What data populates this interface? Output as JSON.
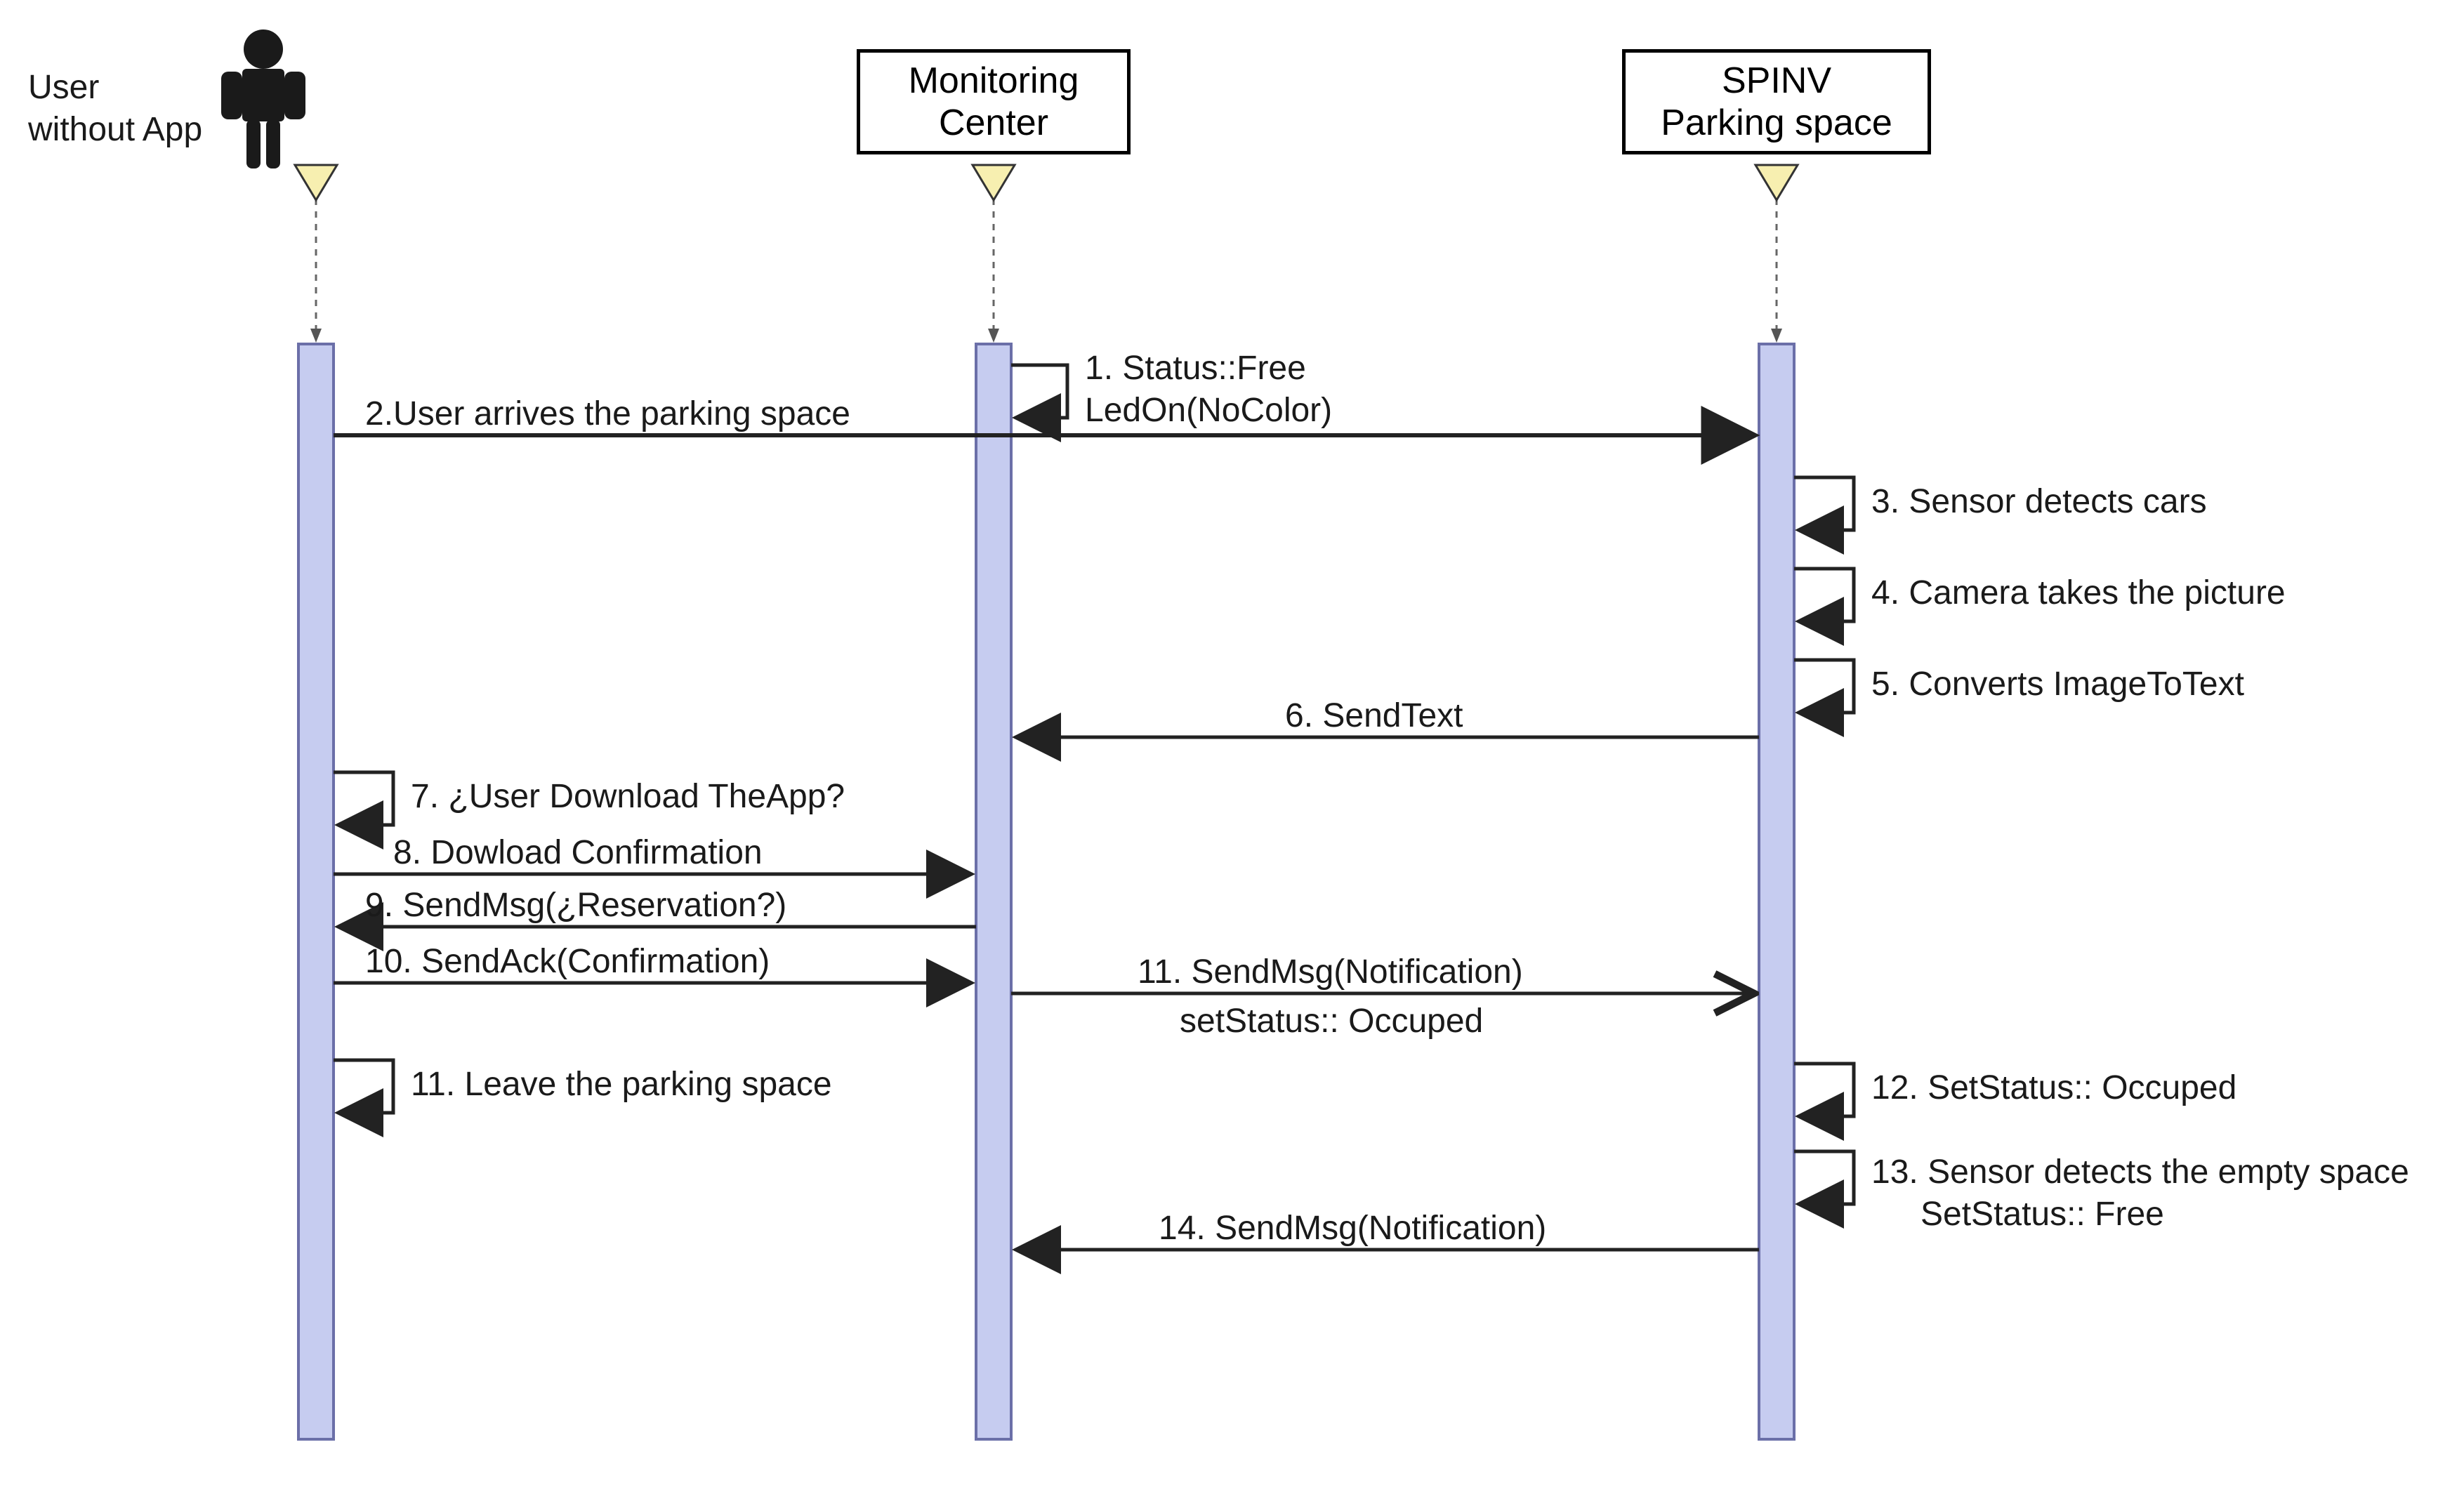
{
  "actors": {
    "user": {
      "lines": [
        "User",
        "without App"
      ]
    },
    "monitor": {
      "lines": [
        "Monitoring",
        "Center"
      ]
    },
    "spinv": {
      "lines": [
        "SPINV",
        "Parking space"
      ]
    }
  },
  "messages": {
    "m1a": "1. Status::Free",
    "m1b": "LedOn(NoColor)",
    "m2": "2.User arrives the parking space",
    "m3": "3. Sensor detects cars",
    "m4": "4. Camera takes the picture",
    "m5": "5. Converts ImageToText",
    "m6": "6. SendText",
    "m7": "7. ¿User Download TheApp?",
    "m8": "8. Dowload Confirmation",
    "m9": "9. SendMsg(¿Reservation?)",
    "m10": "10. SendAck(Confirmation)",
    "m11a": "11. SendMsg(Notification)",
    "m11b": "setStatus:: Occuped",
    "m11c": "11. Leave the parking space",
    "m12": "12. SetStatus:: Occuped",
    "m13a": "13. Sensor detects the empty space",
    "m13b": "SetStatus:: Free",
    "m14": "14. SendMsg(Notification)"
  },
  "style": {
    "lifelineFill": "#c6ccf0",
    "lifelineStroke": "#6b6fa8",
    "triFill": "#f7efb0",
    "ink": "#222222"
  }
}
